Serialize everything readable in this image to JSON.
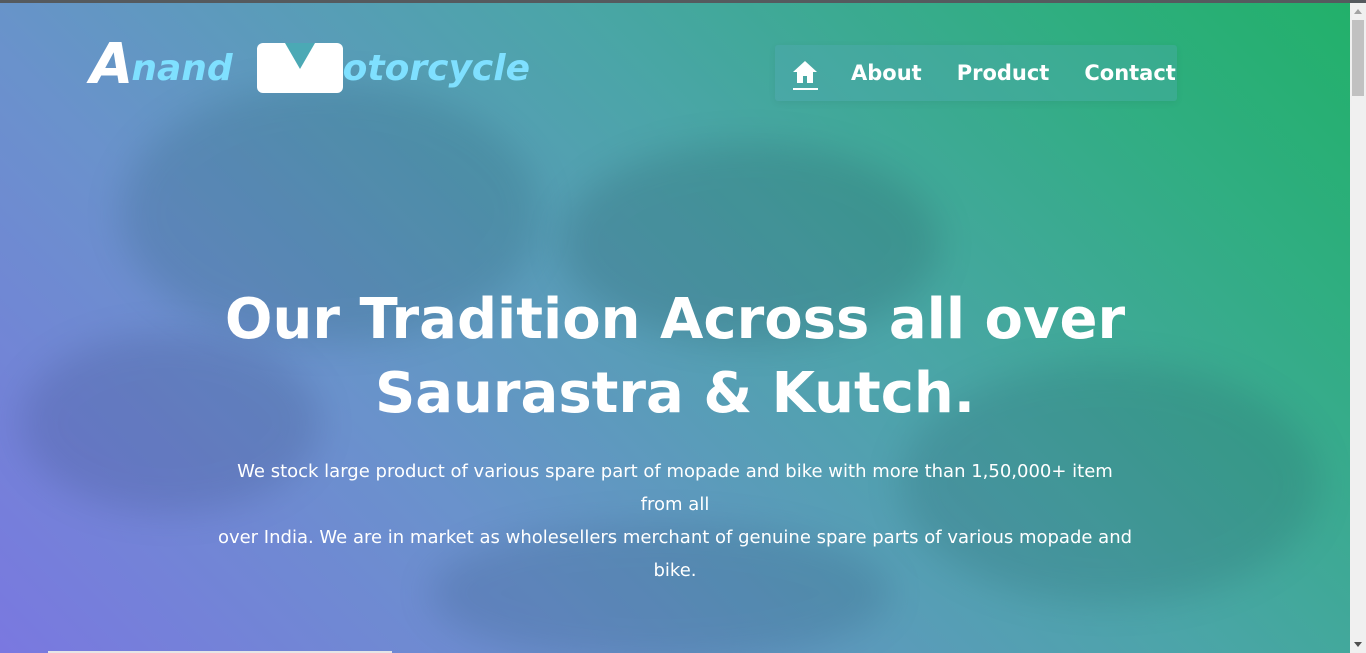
{
  "logo": {
    "letter_a": "A",
    "word_a": "nand",
    "letter_m": "M",
    "word_m": "otorcycle"
  },
  "nav": {
    "home_icon": "home-icon",
    "items": [
      {
        "label": "About"
      },
      {
        "label": "Product"
      },
      {
        "label": "Contact"
      }
    ]
  },
  "hero": {
    "headline_line1": "Our Tradition Across all over",
    "headline_line2": "Saurastra & Kutch.",
    "body_line1": "We stock large product of various spare part of mopade and bike with more than 1,50,000+ item from all",
    "body_line2": "over India. We are in market as wholesellers merchant of genuine spare parts of various mopade and bike."
  },
  "colors": {
    "gradient_start": "#7a78e0",
    "gradient_end": "#22b06a",
    "logo_accent": "#7fe0ff",
    "text": "#ffffff"
  }
}
